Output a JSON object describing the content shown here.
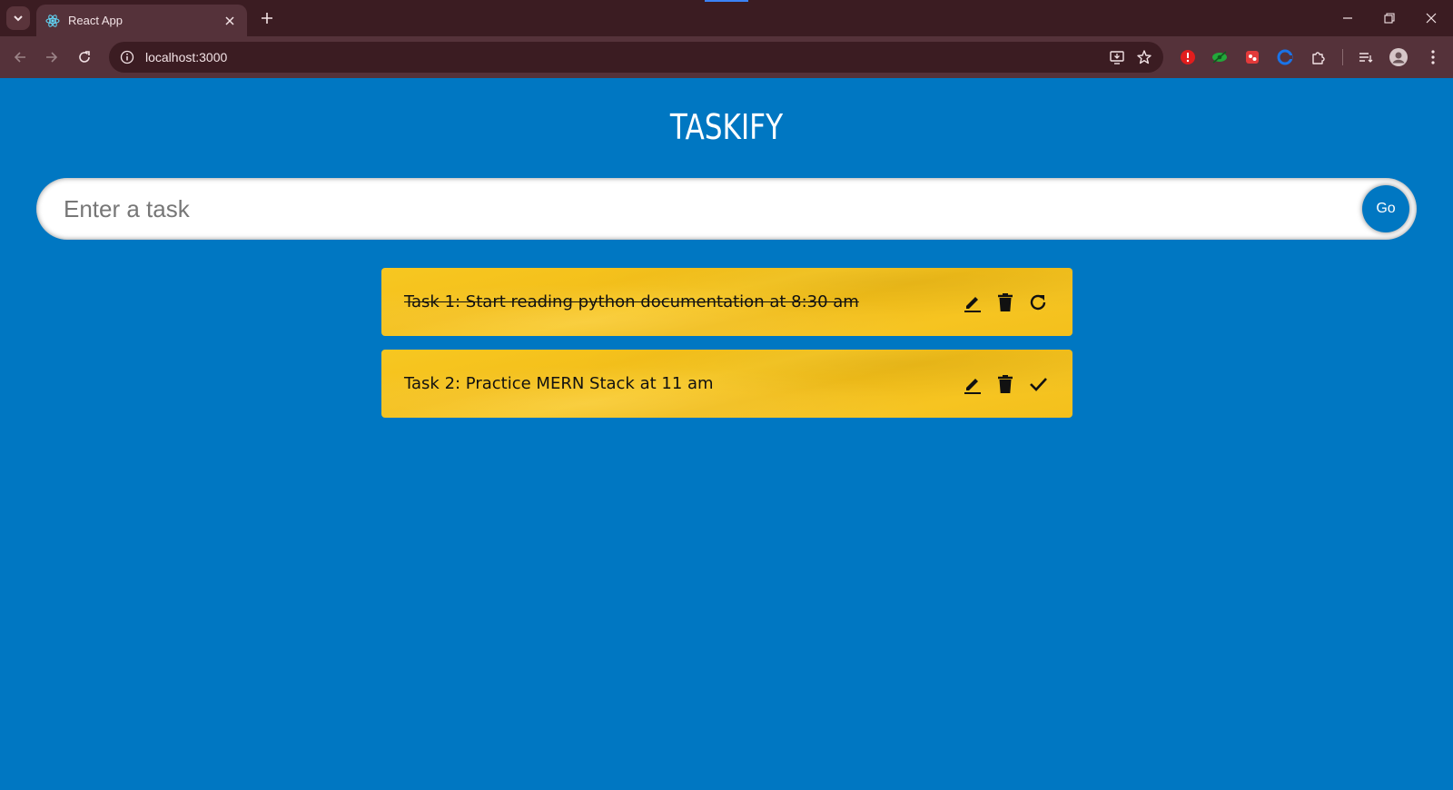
{
  "browser": {
    "tab_title": "React App",
    "url": "localhost:3000"
  },
  "app": {
    "title": "TASKIFY",
    "input_placeholder": "Enter a task",
    "input_value": "",
    "go_label": "Go"
  },
  "todos": [
    {
      "text": "Task 1: Start reading python documentation at 8:30 am",
      "done": true
    },
    {
      "text": "Task 2: Practice MERN Stack at 11 am",
      "done": false
    }
  ],
  "colors": {
    "background": "#0077c2",
    "card": "#f6c522",
    "browser_frame": "#3b1c22"
  }
}
